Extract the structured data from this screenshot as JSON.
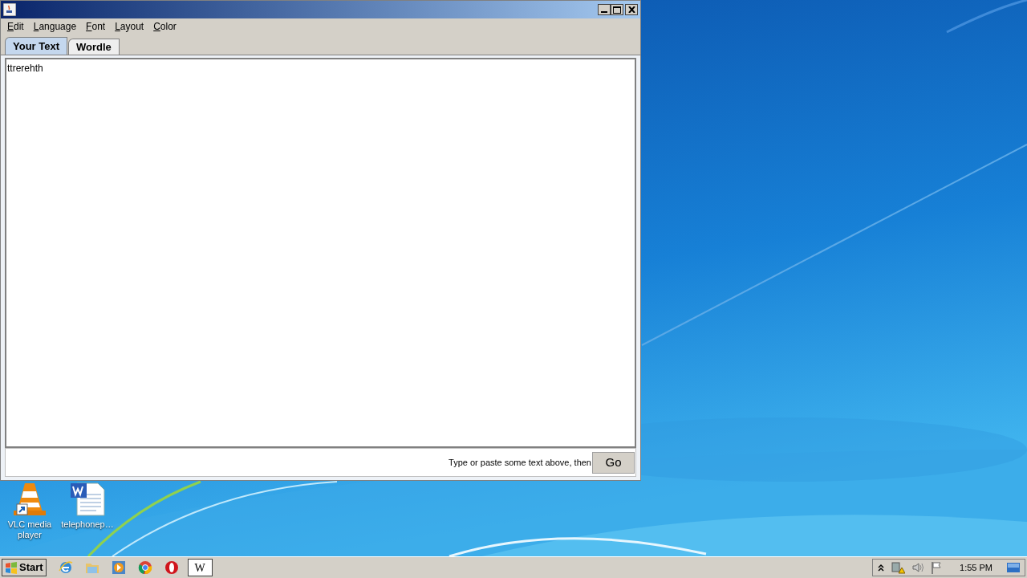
{
  "menu": [
    "Edit",
    "Language",
    "Font",
    "Layout",
    "Color"
  ],
  "tabs": [
    {
      "label": "Your Text",
      "selected": true
    },
    {
      "label": "Wordle",
      "selected": false
    }
  ],
  "editor": {
    "value": "ttrerehth"
  },
  "footer": {
    "hint": "Type or paste some text above, then",
    "go_button": "Go"
  },
  "desktop_icons": [
    {
      "label": "VLC media player",
      "kind": "cone"
    },
    {
      "label": "telephonep…",
      "kind": "document"
    }
  ],
  "taskbar": {
    "start": "Start",
    "apps": [
      {
        "kind": "browser"
      },
      {
        "kind": "folder"
      },
      {
        "kind": "media"
      },
      {
        "kind": "chrome"
      },
      {
        "kind": "opera"
      }
    ],
    "window_button": "W",
    "clock": "1:55 PM"
  }
}
